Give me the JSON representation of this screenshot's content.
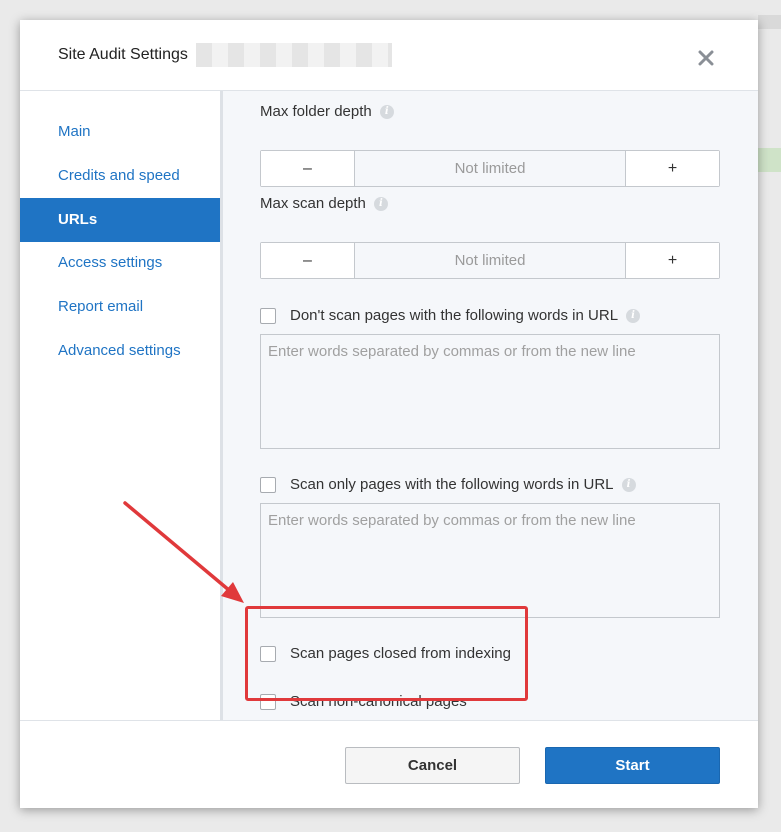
{
  "dialog": {
    "title": "Site Audit Settings",
    "close_icon": "close-icon"
  },
  "sidebar": {
    "items": [
      {
        "label": "Main",
        "active": false
      },
      {
        "label": "Credits and speed",
        "active": false
      },
      {
        "label": "URLs",
        "active": true
      },
      {
        "label": "Access settings",
        "active": false
      },
      {
        "label": "Report email",
        "active": false
      },
      {
        "label": "Advanced settings",
        "active": false
      }
    ]
  },
  "content": {
    "max_folder_depth": {
      "label": "Max folder depth",
      "minus": "–",
      "placeholder": "Not limited",
      "plus": "+"
    },
    "max_scan_depth": {
      "label": "Max scan depth",
      "minus": "–",
      "placeholder": "Not limited",
      "plus": "+"
    },
    "exclude_words": {
      "label": "Don't scan pages with the following words in URL",
      "placeholder": "Enter words separated by commas or from the new line",
      "checked": false
    },
    "include_words": {
      "label": "Scan only pages with the following words in URL",
      "placeholder": "Enter words separated by commas or from the new line",
      "checked": false
    },
    "scan_closed": {
      "label": "Scan pages closed from indexing",
      "checked": false
    },
    "scan_noncanonical": {
      "label": "Scan non-canonical pages",
      "checked": false
    },
    "info_glyph": "i"
  },
  "footer": {
    "cancel_label": "Cancel",
    "start_label": "Start"
  },
  "colors": {
    "accent": "#1f74c4",
    "annotation": "#e0393b"
  }
}
